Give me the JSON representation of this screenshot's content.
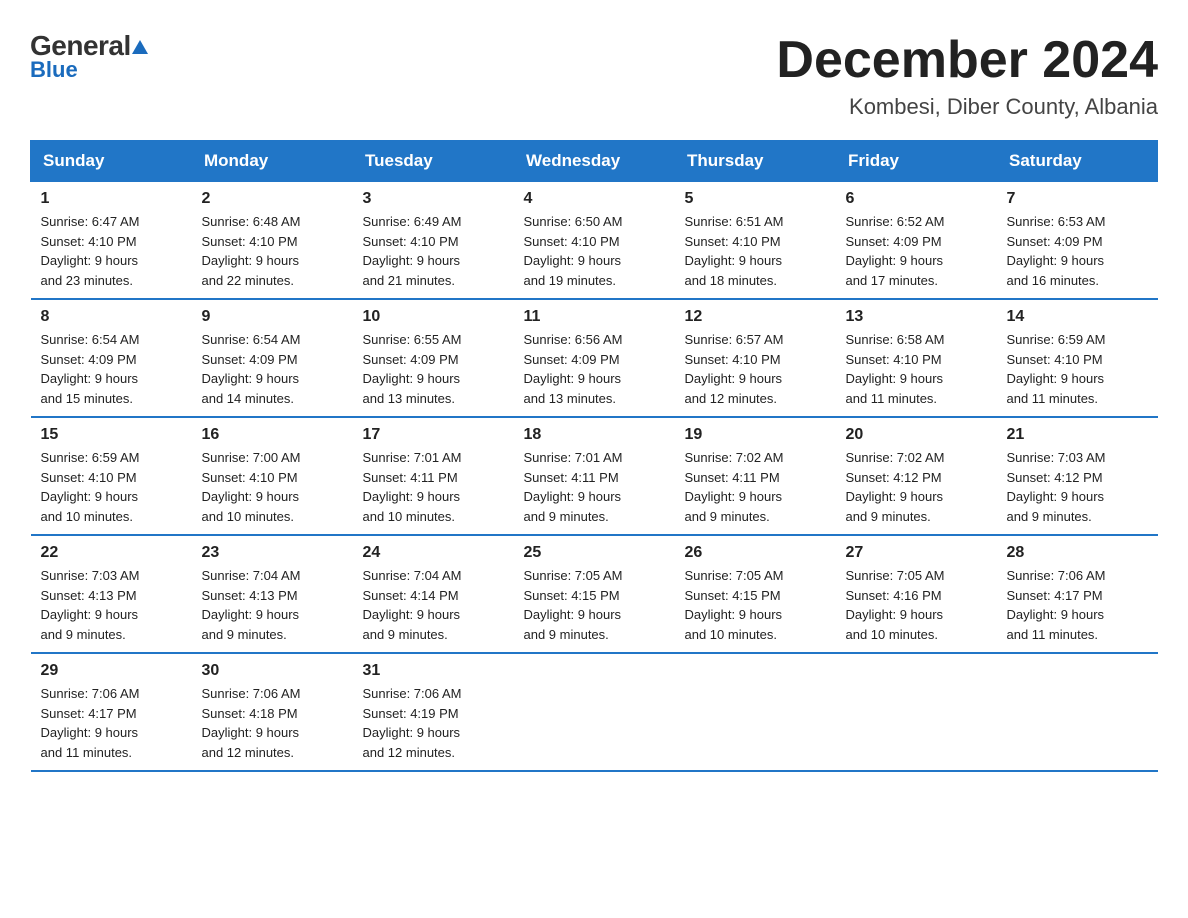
{
  "header": {
    "logo_general": "General",
    "logo_blue": "Blue",
    "title": "December 2024",
    "subtitle": "Kombesi, Diber County, Albania"
  },
  "weekdays": [
    "Sunday",
    "Monday",
    "Tuesday",
    "Wednesday",
    "Thursday",
    "Friday",
    "Saturday"
  ],
  "weeks": [
    [
      {
        "day": "1",
        "sunrise": "6:47 AM",
        "sunset": "4:10 PM",
        "daylight": "9 hours and 23 minutes."
      },
      {
        "day": "2",
        "sunrise": "6:48 AM",
        "sunset": "4:10 PM",
        "daylight": "9 hours and 22 minutes."
      },
      {
        "day": "3",
        "sunrise": "6:49 AM",
        "sunset": "4:10 PM",
        "daylight": "9 hours and 21 minutes."
      },
      {
        "day": "4",
        "sunrise": "6:50 AM",
        "sunset": "4:10 PM",
        "daylight": "9 hours and 19 minutes."
      },
      {
        "day": "5",
        "sunrise": "6:51 AM",
        "sunset": "4:10 PM",
        "daylight": "9 hours and 18 minutes."
      },
      {
        "day": "6",
        "sunrise": "6:52 AM",
        "sunset": "4:09 PM",
        "daylight": "9 hours and 17 minutes."
      },
      {
        "day": "7",
        "sunrise": "6:53 AM",
        "sunset": "4:09 PM",
        "daylight": "9 hours and 16 minutes."
      }
    ],
    [
      {
        "day": "8",
        "sunrise": "6:54 AM",
        "sunset": "4:09 PM",
        "daylight": "9 hours and 15 minutes."
      },
      {
        "day": "9",
        "sunrise": "6:54 AM",
        "sunset": "4:09 PM",
        "daylight": "9 hours and 14 minutes."
      },
      {
        "day": "10",
        "sunrise": "6:55 AM",
        "sunset": "4:09 PM",
        "daylight": "9 hours and 13 minutes."
      },
      {
        "day": "11",
        "sunrise": "6:56 AM",
        "sunset": "4:09 PM",
        "daylight": "9 hours and 13 minutes."
      },
      {
        "day": "12",
        "sunrise": "6:57 AM",
        "sunset": "4:10 PM",
        "daylight": "9 hours and 12 minutes."
      },
      {
        "day": "13",
        "sunrise": "6:58 AM",
        "sunset": "4:10 PM",
        "daylight": "9 hours and 11 minutes."
      },
      {
        "day": "14",
        "sunrise": "6:59 AM",
        "sunset": "4:10 PM",
        "daylight": "9 hours and 11 minutes."
      }
    ],
    [
      {
        "day": "15",
        "sunrise": "6:59 AM",
        "sunset": "4:10 PM",
        "daylight": "9 hours and 10 minutes."
      },
      {
        "day": "16",
        "sunrise": "7:00 AM",
        "sunset": "4:10 PM",
        "daylight": "9 hours and 10 minutes."
      },
      {
        "day": "17",
        "sunrise": "7:01 AM",
        "sunset": "4:11 PM",
        "daylight": "9 hours and 10 minutes."
      },
      {
        "day": "18",
        "sunrise": "7:01 AM",
        "sunset": "4:11 PM",
        "daylight": "9 hours and 9 minutes."
      },
      {
        "day": "19",
        "sunrise": "7:02 AM",
        "sunset": "4:11 PM",
        "daylight": "9 hours and 9 minutes."
      },
      {
        "day": "20",
        "sunrise": "7:02 AM",
        "sunset": "4:12 PM",
        "daylight": "9 hours and 9 minutes."
      },
      {
        "day": "21",
        "sunrise": "7:03 AM",
        "sunset": "4:12 PM",
        "daylight": "9 hours and 9 minutes."
      }
    ],
    [
      {
        "day": "22",
        "sunrise": "7:03 AM",
        "sunset": "4:13 PM",
        "daylight": "9 hours and 9 minutes."
      },
      {
        "day": "23",
        "sunrise": "7:04 AM",
        "sunset": "4:13 PM",
        "daylight": "9 hours and 9 minutes."
      },
      {
        "day": "24",
        "sunrise": "7:04 AM",
        "sunset": "4:14 PM",
        "daylight": "9 hours and 9 minutes."
      },
      {
        "day": "25",
        "sunrise": "7:05 AM",
        "sunset": "4:15 PM",
        "daylight": "9 hours and 9 minutes."
      },
      {
        "day": "26",
        "sunrise": "7:05 AM",
        "sunset": "4:15 PM",
        "daylight": "9 hours and 10 minutes."
      },
      {
        "day": "27",
        "sunrise": "7:05 AM",
        "sunset": "4:16 PM",
        "daylight": "9 hours and 10 minutes."
      },
      {
        "day": "28",
        "sunrise": "7:06 AM",
        "sunset": "4:17 PM",
        "daylight": "9 hours and 11 minutes."
      }
    ],
    [
      {
        "day": "29",
        "sunrise": "7:06 AM",
        "sunset": "4:17 PM",
        "daylight": "9 hours and 11 minutes."
      },
      {
        "day": "30",
        "sunrise": "7:06 AM",
        "sunset": "4:18 PM",
        "daylight": "9 hours and 12 minutes."
      },
      {
        "day": "31",
        "sunrise": "7:06 AM",
        "sunset": "4:19 PM",
        "daylight": "9 hours and 12 minutes."
      },
      null,
      null,
      null,
      null
    ]
  ],
  "labels": {
    "sunrise": "Sunrise:",
    "sunset": "Sunset:",
    "daylight": "Daylight:"
  }
}
